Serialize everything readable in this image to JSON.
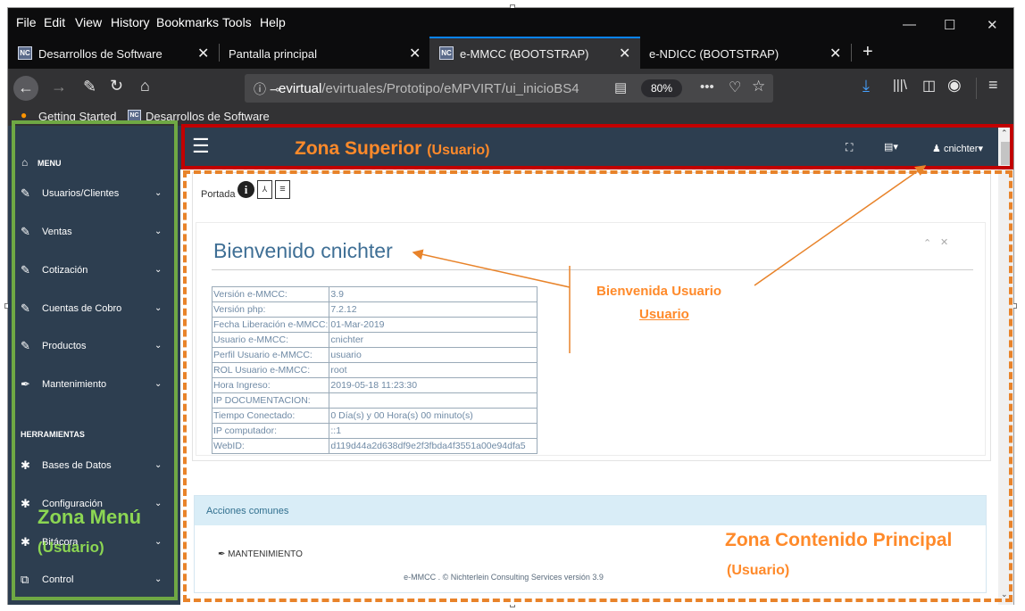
{
  "browser": {
    "menu": [
      "File",
      "Edit",
      "View",
      "History",
      "Bookmarks",
      "Tools",
      "Help"
    ],
    "tabs": [
      {
        "label": "Desarrollos de Software",
        "favicon": true,
        "active": false
      },
      {
        "label": "Pantalla principal",
        "favicon": false,
        "active": false
      },
      {
        "label": "e-MMCC (BOOTSTRAP)",
        "favicon": true,
        "active": true
      },
      {
        "label": "e-NDICC (BOOTSTRAP)",
        "favicon": false,
        "active": false
      }
    ],
    "url_host": "evirtual",
    "url_path": "/evirtuales/Prototipo/eMPVIRT/ui_inicioBS4",
    "zoom": "80%",
    "bookmarks": [
      "Getting Started",
      "Desarrollos de Software"
    ]
  },
  "sidebar": {
    "menu_heading": "MENU",
    "items": [
      {
        "label": "Usuarios/Clientes",
        "icon": "edit-icon"
      },
      {
        "label": "Ventas",
        "icon": "edit-icon"
      },
      {
        "label": "Cotización",
        "icon": "edit-icon"
      },
      {
        "label": "Cuentas de Cobro",
        "icon": "edit-icon"
      },
      {
        "label": "Productos",
        "icon": "edit-icon"
      },
      {
        "label": "Mantenimiento",
        "icon": "wrench-icon"
      }
    ],
    "tools_heading": "HERRAMIENTAS",
    "tools": [
      {
        "label": "Bases de Datos",
        "icon": "gear-icon"
      },
      {
        "label": "Configuración",
        "icon": "gear-icon"
      },
      {
        "label": "Bitácora",
        "icon": "gear-icon"
      },
      {
        "label": "Control",
        "icon": "copy-icon"
      }
    ]
  },
  "topbar": {
    "user": "cnichter"
  },
  "content": {
    "breadcrumb": "Portada",
    "welcome": "Bienvenido cnichter",
    "info_rows": [
      {
        "k": "Versión e-MMCC:",
        "v": "3.9"
      },
      {
        "k": "Versión php:",
        "v": "7.2.12"
      },
      {
        "k": "Fecha Liberación e-MMCC:",
        "v": "01-Mar-2019"
      },
      {
        "k": "Usuario e-MMCC:",
        "v": "cnichter"
      },
      {
        "k": "Perfil Usuario e-MMCC:",
        "v": "usuario"
      },
      {
        "k": "ROL Usuario e-MMCC:",
        "v": "root"
      },
      {
        "k": "Hora Ingreso:",
        "v": "2019-05-18 11:23:30"
      },
      {
        "k": "IP DOCUMENTACION:",
        "v": ""
      },
      {
        "k": "Tiempo Conectado:",
        "v": "0 Día(s) y 00 Hora(s) 00 minuto(s)"
      },
      {
        "k": "IP computador:",
        "v": "::1"
      },
      {
        "k": "WebID:",
        "v": "d119d44a2d638df9e2f3fbda4f3551a00e94dfa5"
      }
    ],
    "acciones_title": "Acciones comunes",
    "mantenimiento": "MANTENIMIENTO",
    "footer": "e-MMCC . © Nichterlein Consulting Services versión 3.9"
  },
  "annotations": {
    "zona_superior": "Zona Superior",
    "zona_superior_sub": "(Usuario)",
    "bienvenida_1": "Bienvenida Usuario",
    "bienvenida_2": "Usuario",
    "zona_menu": "Zona Menú",
    "zona_menu_sub": "(Usuario)",
    "zona_contenido": "Zona Contenido Principal",
    "zona_contenido_sub": "(Usuario)"
  },
  "colors": {
    "sidebar": "#2d3e50",
    "annotation_orange": "#e8832a",
    "annotation_red": "#c20000",
    "annotation_green": "#6fa844"
  }
}
